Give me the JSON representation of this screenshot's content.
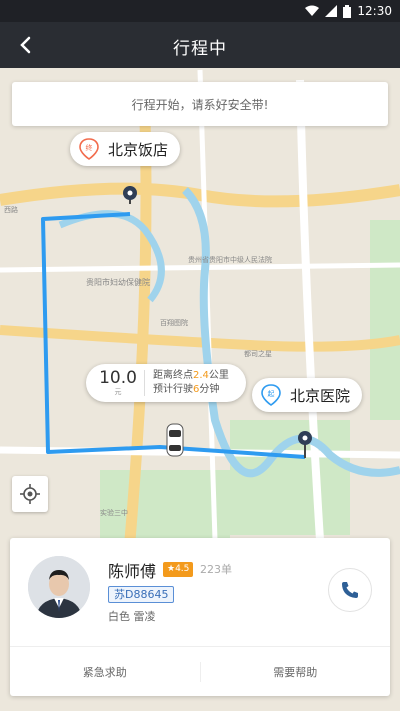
{
  "status": {
    "time": "12:30"
  },
  "nav": {
    "title": "行程中"
  },
  "banner": {
    "text": "行程开始，请系好安全带!"
  },
  "map": {
    "origin_label": "北京饭店",
    "destination_label": "北京医院",
    "origin_pin_char": "终",
    "destination_pin_char": "起",
    "route_color": "#2e9bf0",
    "place_labels": [
      "贵阳市妇幼保健院",
      "贵州省贵阳市中级人民法院",
      "都司之星",
      "实验三中",
      "百翔图院",
      "西路"
    ]
  },
  "eta": {
    "value": "10.0",
    "unit": "元",
    "line1_prefix": "距离终点",
    "line1_value": "2.4",
    "line1_suffix": "公里",
    "line2_prefix": "预计行驶",
    "line2_value": "6",
    "line2_suffix": "分钟"
  },
  "driver": {
    "name": "陈师傅",
    "rating": "4.5",
    "orders": "223单",
    "plate": "苏D88645",
    "car": "白色 雷凌"
  },
  "actions": {
    "emergency": "紧急求助",
    "help": "需要帮助"
  },
  "colors": {
    "accent": "#f39a1c",
    "route": "#2e9bf0",
    "header": "#2a2d33"
  }
}
